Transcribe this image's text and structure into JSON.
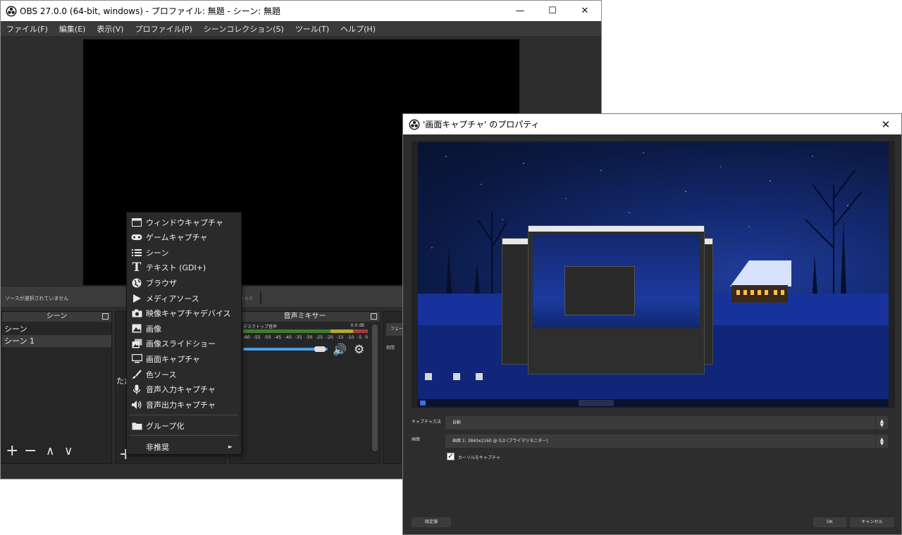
{
  "main_window": {
    "title": "OBS 27.0.0 (64-bit, windows) - プロファイル: 無題 - シーン: 無題",
    "controls": {
      "minimize": "—",
      "maximize": "☐",
      "close": "✕"
    },
    "menu": [
      "ファイル(F)",
      "編集(E)",
      "表示(V)",
      "プロファイル(P)",
      "シーンコレクション(S)",
      "ツール(T)",
      "ヘルプ(H)"
    ],
    "status": {
      "no_source": "ソースが選択されていません",
      "filter_ghost": "ィルタ"
    },
    "scenes_dock": {
      "title": "シーン",
      "items": [
        "シーン",
        "シーン 1"
      ],
      "toolbar": {
        "add": "+",
        "remove": "−",
        "up": "∧",
        "down": "∨"
      }
    },
    "sources_dock": {
      "hint": "ただ",
      "add": "+"
    },
    "mixer_dock": {
      "title": "音声ミキサー",
      "track": "デスクトップ音声",
      "db": "0.0 dB",
      "ticks": [
        "-60",
        "-55",
        "-50",
        "-45",
        "-40",
        "-35",
        "-30",
        "-25",
        "-20",
        "-15",
        "-10",
        "-5",
        "0"
      ]
    },
    "transition_dock": {
      "button": "フェード",
      "label": "期間"
    }
  },
  "context_menu": {
    "items": [
      {
        "label": "ウィンドウキャプチャ",
        "icon": "window-icon"
      },
      {
        "label": "ゲームキャプチャ",
        "icon": "gamepad-icon"
      },
      {
        "label": "シーン",
        "icon": "list-icon"
      },
      {
        "label": "テキスト (GDI+)",
        "icon": "text-icon"
      },
      {
        "label": "ブラウザ",
        "icon": "globe-icon"
      },
      {
        "label": "メディアソース",
        "icon": "play-icon"
      },
      {
        "label": "映像キャプチャデバイス",
        "icon": "camera-icon"
      },
      {
        "label": "画像",
        "icon": "image-icon"
      },
      {
        "label": "画像スライドショー",
        "icon": "slideshow-icon"
      },
      {
        "label": "画面キャプチャ",
        "icon": "monitor-icon"
      },
      {
        "label": "色ソース",
        "icon": "brush-icon"
      },
      {
        "label": "音声入力キャプチャ",
        "icon": "microphone-icon"
      },
      {
        "label": "音声出力キャプチャ",
        "icon": "speaker-icon"
      }
    ],
    "group": {
      "label": "グループ化",
      "icon": "folder-icon"
    },
    "deprecated": {
      "label": "非推奨",
      "arrow": "►"
    }
  },
  "properties": {
    "title": "'画面キャプチャ' のプロパティ",
    "close": "✕",
    "capture_method_label": "キャプチャ方法",
    "capture_method_value": "自動",
    "display_label": "画面",
    "display_value": "画面 1: 3840x2160 @ 0,0 (プライマリモニター)",
    "cursor_label": "カーソルをキャプチャ",
    "cursor_checked": "✓",
    "buttons": {
      "defaults": "既定値",
      "ok": "OK",
      "cancel": "キャンセル"
    }
  }
}
